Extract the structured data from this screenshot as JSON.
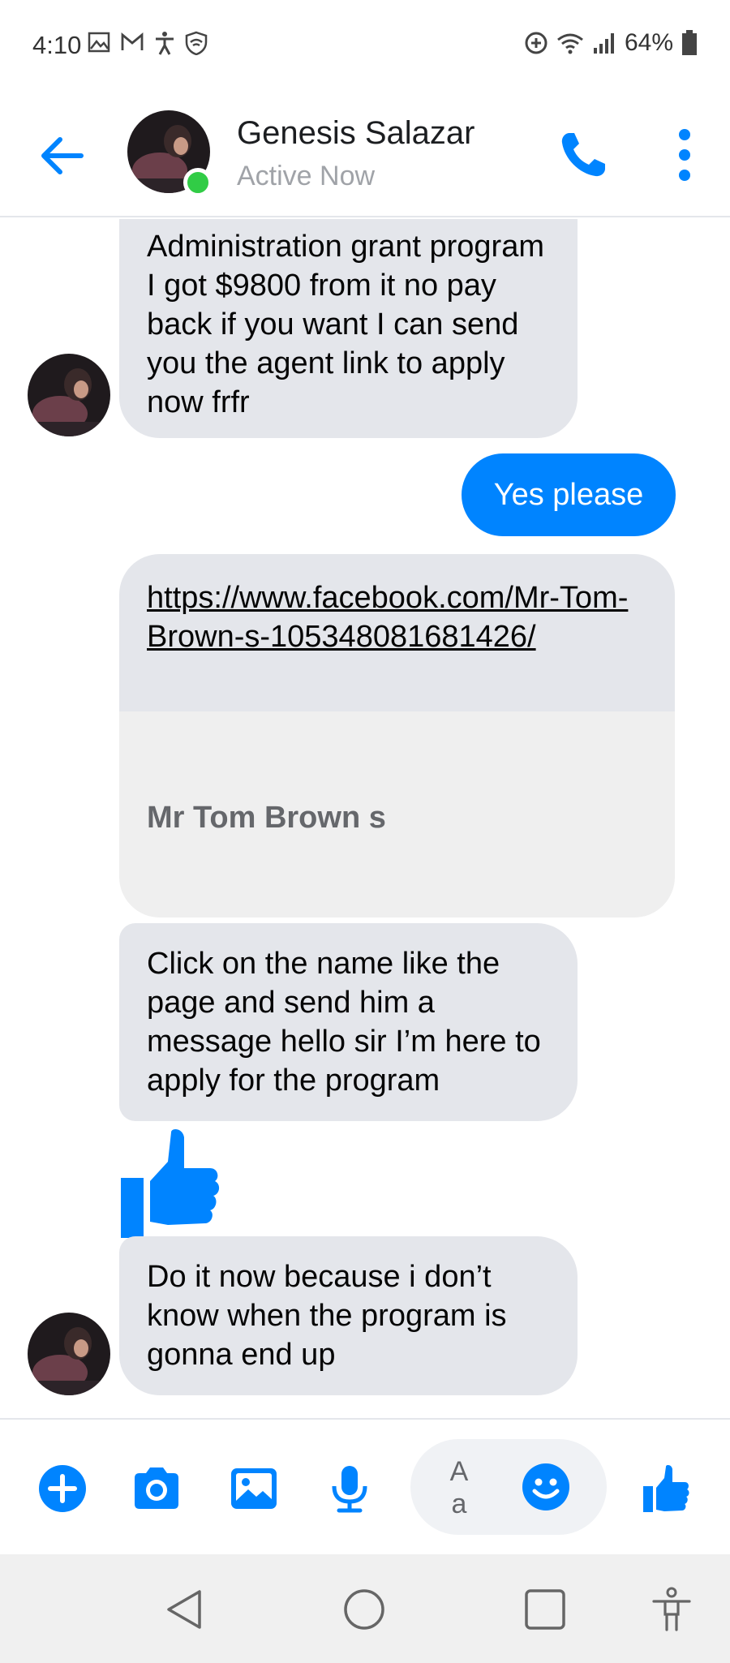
{
  "status_bar": {
    "time": "4:10",
    "battery": "64%",
    "left_icons": [
      "gallery-icon",
      "gmail-icon",
      "accessibility-icon",
      "vpn-shield-icon"
    ],
    "right_icons": [
      "data-saver-icon",
      "wifi-icon",
      "signal-icon",
      "battery-icon"
    ]
  },
  "header": {
    "name": "Genesis Salazar",
    "status": "Active Now",
    "colors": {
      "accent": "#0084ff",
      "online": "#31cc46"
    }
  },
  "messages": [
    {
      "from": "contact",
      "text": "Administration grant program I got $9800 from it no pay back if you want I can send you the agent link to apply now frfr"
    },
    {
      "from": "me",
      "text": "Yes please"
    },
    {
      "from": "contact",
      "link": "https://www.facebook.com/Mr-Tom-Brown-s-105348081681426/",
      "card_title": "Mr Tom Brown s"
    },
    {
      "from": "contact",
      "text": "Click on the name like the page and send him a message hello sir I’m here to apply for the program"
    },
    {
      "from": "contact",
      "sticker": "thumbs-up"
    },
    {
      "from": "contact",
      "text": "Do it now because i don’t know when the program is gonna end up"
    }
  ],
  "composer": {
    "placeholder": "A\na",
    "icons": [
      "plus-icon",
      "camera-icon",
      "image-icon",
      "microphone-icon",
      "emoji-icon",
      "thumbs-up-icon"
    ]
  },
  "nav_bar": {
    "icons": [
      "back-triangle-icon",
      "home-circle-icon",
      "recents-square-icon",
      "accessibility-icon"
    ]
  }
}
